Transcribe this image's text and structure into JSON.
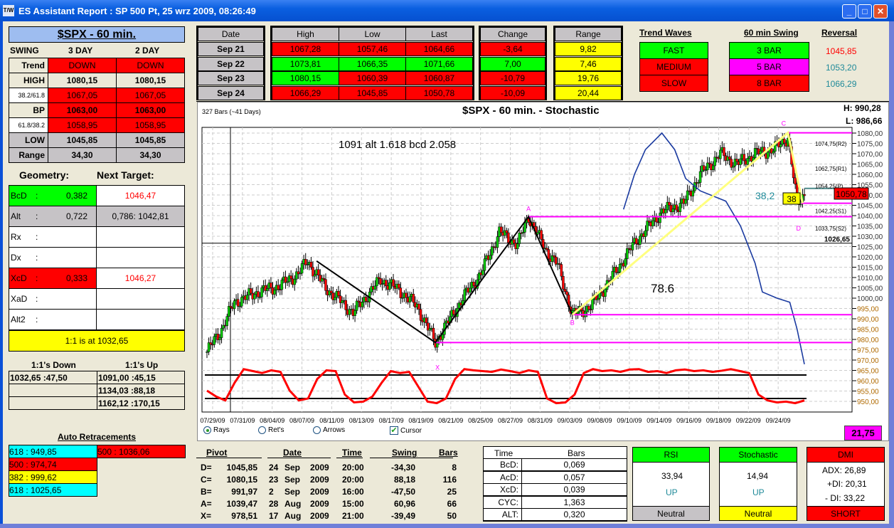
{
  "window": {
    "title": "ES Assistant Report : SP 500  Pt, 25 wrz 2009, 08:26:49",
    "app_icon": "app-icon",
    "buttons": [
      "_",
      "□",
      "✕"
    ]
  },
  "left": {
    "header": "$SPX - 60 min.",
    "swing_headers": [
      "SWING",
      "3 DAY",
      "2 DAY"
    ],
    "swing_rows": [
      {
        "label": "Trend",
        "v3": "DOWN",
        "v2": "DOWN",
        "lbg": "#ece9d8",
        "bg": "#ff0000",
        "small": false,
        "bold": false
      },
      {
        "label": "HIGH",
        "v3": "1080,15",
        "v2": "1080,15",
        "lbg": "#ece9d8",
        "bg": "#ece9d8",
        "small": false,
        "bold": true
      },
      {
        "label": "38.2/61.8",
        "v3": "1067,05",
        "v2": "1067,05",
        "lbg": "#ffffff",
        "bg": "#ff0000",
        "small": true,
        "bold": false
      },
      {
        "label": "BP",
        "v3": "1063,00",
        "v2": "1063,00",
        "lbg": "#ece9d8",
        "bg": "#ff0000",
        "small": false,
        "bold": true
      },
      {
        "label": "61.8/38.2",
        "v3": "1058,95",
        "v2": "1058,95",
        "lbg": "#ffffff",
        "bg": "#ff0000",
        "small": true,
        "bold": false
      },
      {
        "label": "LOW",
        "v3": "1045,85",
        "v2": "1045,85",
        "lbg": "#c6c3c6",
        "bg": "#c6c3c6",
        "small": false,
        "bold": true
      },
      {
        "label": "Range",
        "v3": "34,30",
        "v2": "34,30",
        "lbg": "#c6c3c6",
        "bg": "#c6c3c6",
        "small": false,
        "bold": true
      }
    ],
    "geometry_title": "Geometry:",
    "target_title": "Next Target:",
    "geometry_rows": [
      {
        "label": "BcD",
        "sep": ":",
        "value": "0,382",
        "target": "1046,47",
        "bg": "#00ff00",
        "tbg": "#ffffff",
        "tcolor": "#ff0000"
      },
      {
        "label": "Alt",
        "sep": ":",
        "value": "0,722",
        "target": "0,786: 1042,81",
        "bg": "#c6c3c6",
        "tbg": "#c6c3c6",
        "tcolor": "#000000"
      },
      {
        "label": "Rx",
        "sep": ":",
        "value": "",
        "target": "",
        "bg": "#ffffff",
        "tbg": "#ffffff",
        "tcolor": "#000000"
      },
      {
        "label": "Dx",
        "sep": ":",
        "value": "",
        "target": "",
        "bg": "#ffffff",
        "tbg": "#ffffff",
        "tcolor": "#000000"
      },
      {
        "label": "XcD",
        "sep": ":",
        "value": "0,333",
        "target": "1046,27",
        "bg": "#ff0000",
        "tbg": "#ffffff",
        "tcolor": "#ff0000"
      },
      {
        "label": "XaD",
        "sep": ":",
        "value": "",
        "target": "",
        "bg": "#ffffff",
        "tbg": "#ffffff",
        "tcolor": "#000000"
      },
      {
        "label": "Alt2",
        "sep": ":",
        "value": "",
        "target": "",
        "bg": "#ffffff",
        "tbg": "#ffffff",
        "tcolor": "#000000"
      }
    ],
    "one_to_one": "1:1 is at 1032,65",
    "ones_down_title": "1:1's Down",
    "ones_up_title": "1:1's Up",
    "ones_down": [
      "1032,65 :47,50",
      "",
      ""
    ],
    "ones_up": [
      "1091,00 :45,15",
      "1134,03 :88,18",
      "1162,12 :170,15"
    ],
    "auto_ret_title": "Auto Retracements",
    "auto_ret_left": [
      {
        "text": "618 : 949,85",
        "bg": "#00ffff"
      },
      {
        "text": "500 : 974,74",
        "bg": "#ff0000"
      },
      {
        "text": "382 : 999,62",
        "bg": "#ffff00"
      },
      {
        "text": "618 : 1025,65",
        "bg": "#00ffff"
      }
    ],
    "auto_ret_right": [
      {
        "text": "500 : 1036,06",
        "bg": "#ff0000"
      }
    ]
  },
  "daily": {
    "headers": {
      "date": "Date",
      "high": "High",
      "low": "Low",
      "last": "Last",
      "change": "Change",
      "range": "Range"
    },
    "rows": [
      {
        "date": "Sep  21",
        "high": "1067,28",
        "hb": "#ff0000",
        "low": "1057,46",
        "lb": "#ff0000",
        "last": "1064,66",
        "sb": "#ff0000",
        "change": "-3,64",
        "cb": "#ff0000",
        "range": "9,82"
      },
      {
        "date": "Sep  22",
        "high": "1073,81",
        "hb": "#00ff00",
        "low": "1066,35",
        "lb": "#00ff00",
        "last": "1071,66",
        "sb": "#00ff00",
        "change": "7,00",
        "cb": "#00ff00",
        "range": "7,46"
      },
      {
        "date": "Sep  23",
        "high": "1080,15",
        "hb": "#00ff00",
        "low": "1060,39",
        "lb": "#ff0000",
        "last": "1060,87",
        "sb": "#ff0000",
        "change": "-10,79",
        "cb": "#ff0000",
        "range": "19,76"
      },
      {
        "date": "Sep  24",
        "high": "1066,29",
        "hb": "#ff0000",
        "low": "1045,85",
        "lb": "#ff0000",
        "last": "1050,78",
        "sb": "#ff0000",
        "change": "-10,09",
        "cb": "#ff0000",
        "range": "20,44"
      }
    ]
  },
  "trend": {
    "title": "Trend Waves",
    "items": [
      {
        "label": "FAST",
        "bg": "#00ff00"
      },
      {
        "label": "MEDIUM",
        "bg": "#ff0000"
      },
      {
        "label": "SLOW",
        "bg": "#ff0000"
      }
    ]
  },
  "swing60": {
    "title": "60 min Swing",
    "items": [
      {
        "label": "3 BAR",
        "bg": "#00ff00"
      },
      {
        "label": "5 BAR",
        "bg": "#ff00ff"
      },
      {
        "label": "8 BAR",
        "bg": "#ff0000"
      }
    ]
  },
  "reversal": {
    "title": "Reversal",
    "items": [
      {
        "value": "1045,85",
        "color": "#ff0000"
      },
      {
        "value": "1053,20",
        "color": "#1f8a99"
      },
      {
        "value": "1066,29",
        "color": "#1f8a99"
      }
    ]
  },
  "chart": {
    "bars_label": "327 Bars (~41 Days)",
    "title": "$SPX - 60 min. - Stochastic",
    "high": "H: 990,28",
    "low": "L: 986,66",
    "annotation": "1091 alt 1.618 bcd 2.058",
    "retrace_786": "78.6",
    "retrace_382": "38,2",
    "box_38": "38",
    "last_price": "1050,78",
    "level_1026": "1026,65",
    "pivot_levels": [
      {
        "text": "1074,75(R2)",
        "price": 1074.75
      },
      {
        "text": "1062,75(R1)",
        "price": 1062.75
      },
      {
        "text": "1054,25(P)",
        "price": 1054.25
      },
      {
        "text": "1042,25(S1)",
        "price": 1042.25
      },
      {
        "text": "1033,75(S2)",
        "price": 1033.75
      }
    ],
    "point_labels": {
      "A": "A",
      "B": "B",
      "C": "C",
      "D": "D",
      "X": "X"
    },
    "price_ticks": [
      "1080,00",
      "1075,00",
      "1070,00",
      "1065,00",
      "1060,00",
      "1055,00",
      "1050,00",
      "1045,00",
      "1040,00",
      "1035,00",
      "1030,00",
      "1025,00",
      "1020,00",
      "1015,00",
      "1010,00",
      "1005,00",
      "1000,00",
      "995,00",
      "990,00",
      "985,00",
      "980,00",
      "975,00",
      "970,00",
      "965,00",
      "960,00",
      "955,00",
      "950,00"
    ],
    "date_ticks": [
      "07/29/09",
      "07/31/09",
      "08/04/09",
      "08/07/09",
      "08/11/09",
      "08/13/09",
      "08/17/09",
      "08/19/09",
      "08/21/09",
      "08/25/09",
      "08/27/09",
      "08/31/09",
      "09/03/09",
      "09/08/09",
      "09/10/09",
      "09/14/09",
      "09/16/09",
      "09/18/09",
      "09/22/09",
      "09/24/09"
    ],
    "options": [
      {
        "label": "Rays",
        "type": "radio",
        "checked": true
      },
      {
        "label": "Ret's",
        "type": "radio",
        "checked": false
      },
      {
        "label": "Arrows",
        "type": "radio",
        "checked": false
      },
      {
        "label": "Cursor",
        "type": "checkbox",
        "checked": true
      }
    ],
    "stoch_value": "21,75"
  },
  "chart_data": {
    "type": "candlestick",
    "title": "$SPX - 60 min. - Stochastic",
    "bars": 327,
    "ylim": [
      947,
      1082
    ],
    "price_waypoints": [
      [
        0,
        974
      ],
      [
        8,
        985
      ],
      [
        15,
        998
      ],
      [
        28,
        1003
      ],
      [
        40,
        1006
      ],
      [
        50,
        1012
      ],
      [
        55,
        1018
      ],
      [
        65,
        1005
      ],
      [
        80,
        993
      ],
      [
        95,
        1009
      ],
      [
        105,
        1004
      ],
      [
        115,
        996
      ],
      [
        125,
        978.5
      ],
      [
        140,
        1000
      ],
      [
        150,
        1012
      ],
      [
        160,
        1032
      ],
      [
        170,
        1026
      ],
      [
        176,
        1039.5
      ],
      [
        185,
        1024
      ],
      [
        192,
        1016
      ],
      [
        200,
        992
      ],
      [
        210,
        996
      ],
      [
        220,
        1008
      ],
      [
        235,
        1028
      ],
      [
        249,
        1042
      ],
      [
        261,
        1046
      ],
      [
        270,
        1060
      ],
      [
        281,
        1070
      ],
      [
        290,
        1065
      ],
      [
        300,
        1070
      ],
      [
        310,
        1072
      ],
      [
        318,
        1078
      ],
      [
        323,
        1045.85
      ],
      [
        327,
        1050.78
      ]
    ],
    "pivots": [
      {
        "name": "X",
        "bar": 125,
        "price": 978.51
      },
      {
        "name": "A",
        "bar": 176,
        "price": 1039.47
      },
      {
        "name": "B",
        "bar": 200,
        "price": 991.97
      },
      {
        "name": "C",
        "bar": 318,
        "price": 1080.15
      },
      {
        "name": "D",
        "bar": 323,
        "price": 1045.85
      }
    ],
    "pattern_start": {
      "bar": 60,
      "price": 1018
    },
    "horizontal_levels": [
      1080.15,
      1046,
      1039.47,
      991.97,
      978.51
    ],
    "overlay_line": [
      [
        228,
        1043
      ],
      [
        234,
        1060
      ],
      [
        240,
        1072
      ],
      [
        249,
        1080
      ],
      [
        256,
        1072
      ],
      [
        262,
        1058
      ],
      [
        270,
        1052
      ],
      [
        284,
        1047
      ],
      [
        292,
        1035
      ],
      [
        300,
        1017
      ],
      [
        304,
        1003
      ],
      [
        312,
        1000
      ],
      [
        319,
        998
      ],
      [
        323,
        985
      ],
      [
        327,
        968
      ]
    ],
    "stochastic": [
      40,
      25,
      15,
      60,
      95,
      90,
      85,
      92,
      88,
      40,
      15,
      20,
      70,
      92,
      90,
      30,
      10,
      12,
      25,
      60,
      90,
      85,
      88,
      50,
      12,
      8,
      20,
      70,
      95,
      92,
      90,
      88,
      94,
      90,
      85,
      92,
      88,
      20,
      8,
      10,
      30,
      85,
      95,
      90,
      92,
      88,
      94,
      95,
      88,
      90,
      85,
      92,
      94,
      90,
      92,
      88,
      91,
      95,
      90,
      85,
      30,
      15,
      10,
      12,
      8,
      15
    ],
    "stoch_levels": [
      80,
      20
    ]
  },
  "pivot_table": {
    "headers": [
      "Pivot",
      "Date",
      "Time",
      "Swing",
      "Bars"
    ],
    "rows": [
      {
        "name": "D=",
        "price": "1045,85",
        "day": "24",
        "mon": "Sep",
        "year": "2009",
        "time": "20:00",
        "swing": "-34,30",
        "bars": "8"
      },
      {
        "name": "C=",
        "price": "1080,15",
        "day": "23",
        "mon": "Sep",
        "year": "2009",
        "time": "20:00",
        "swing": "88,18",
        "bars": "116"
      },
      {
        "name": "B=",
        "price": "991,97",
        "day": "2",
        "mon": "Sep",
        "year": "2009",
        "time": "16:00",
        "swing": "-47,50",
        "bars": "25"
      },
      {
        "name": "A=",
        "price": "1039,47",
        "day": "28",
        "mon": "Aug",
        "year": "2009",
        "time": "15:00",
        "swing": "60,96",
        "bars": "66"
      },
      {
        "name": "X=",
        "price": "978,51",
        "day": "17",
        "mon": "Aug",
        "year": "2009",
        "time": "21:00",
        "swing": "-39,49",
        "bars": "50"
      }
    ]
  },
  "time_table": {
    "headers": [
      "Time",
      "Bars"
    ],
    "rows": [
      {
        "label": "BcD:",
        "value": "0,069"
      },
      {
        "label": "AcD:",
        "value": "0,057"
      },
      {
        "label": "XcD:",
        "value": "0,039"
      },
      {
        "label": "CYC:",
        "value": "1,363"
      },
      {
        "label": "ALT:",
        "value": "0,320"
      }
    ]
  },
  "rsi": {
    "title": "RSI",
    "value": "33,94",
    "dir": "UP",
    "status": "Neutral",
    "status_bg": "#c6c3c6"
  },
  "stoch": {
    "title": "Stochastic",
    "value": "14,94",
    "dir": "UP",
    "status": "Neutral",
    "status_bg": "#ffff00"
  },
  "dmi": {
    "title": "DMI",
    "adx": "ADX:  26,89",
    "pdi": "+DI:  20,31",
    "mdi": "- DI:  33,22",
    "status": "SHORT"
  }
}
